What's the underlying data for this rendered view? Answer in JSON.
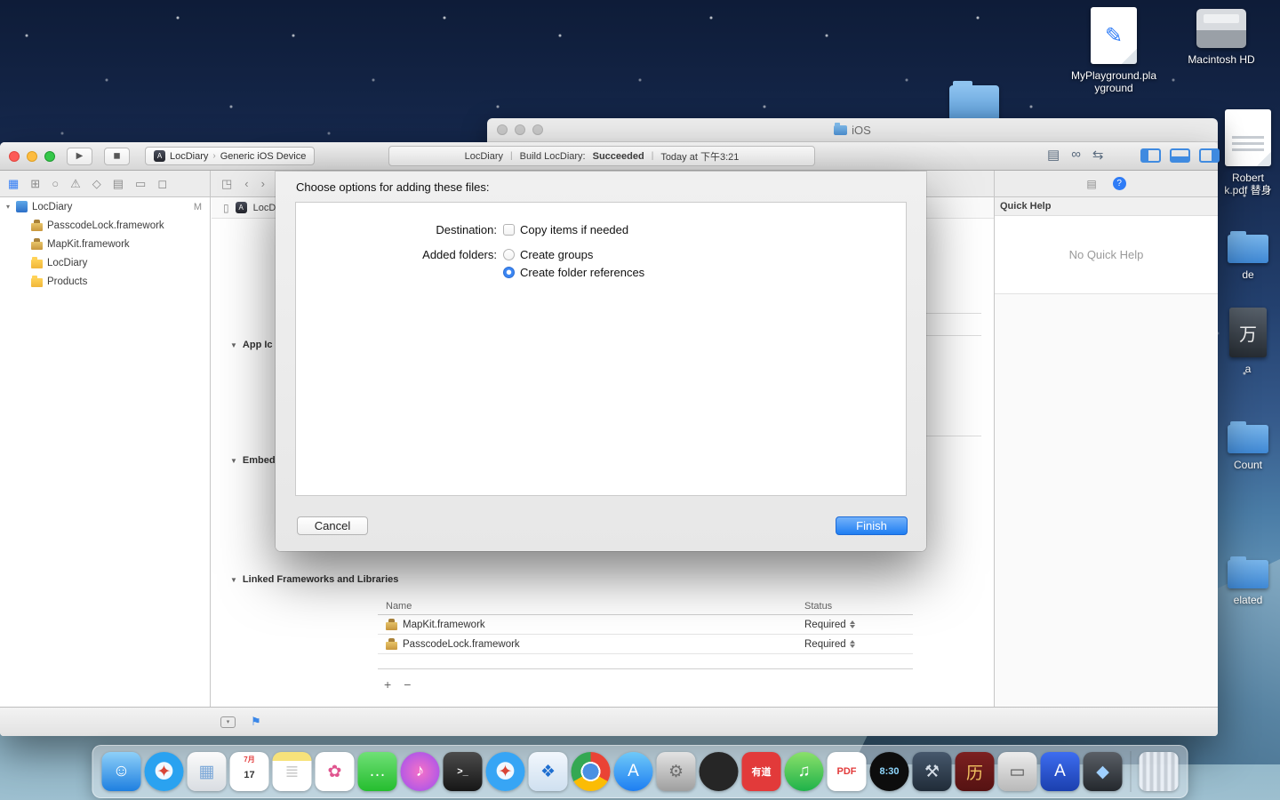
{
  "desktop": {
    "top_icons": [
      {
        "name": "myplayground-icon",
        "type": "playground",
        "glyph": "✎",
        "line1": "MyPlayground.pla",
        "line2": "yground"
      },
      {
        "name": "macintosh-hd-icon",
        "type": "harddrive",
        "glyph": "",
        "line1": "Macintosh HD",
        "line2": ""
      }
    ],
    "right_items": [
      {
        "name": "pdf-alias",
        "type": "pdf",
        "glyph": "",
        "line1": "Robert",
        "line2": "k.pdf 替身"
      },
      {
        "name": "folder-de",
        "type": "folder",
        "glyph": "",
        "line1": "de",
        "line2": ""
      },
      {
        "name": "artwork-a",
        "type": "artwork",
        "glyph": "万",
        "line1": "a",
        "line2": ""
      },
      {
        "name": "folder-count",
        "type": "folder",
        "glyph": "",
        "line1": "Count",
        "line2": ""
      },
      {
        "name": "folder-related",
        "type": "folder",
        "glyph": "",
        "line1": "elated",
        "line2": ""
      }
    ]
  },
  "finder": {
    "title": "iOS"
  },
  "xcode": {
    "toolbar": {
      "play": "▶",
      "stop": "◼",
      "scheme_icon": "A",
      "scheme_name": "LocDiary",
      "scheme_chevron": "›",
      "device": "Generic iOS Device",
      "status_project": "LocDiary",
      "status_sep": "|",
      "status_build": "Build LocDiary:",
      "status_state": "Succeeded",
      "status_time": "Today at 下午3:21"
    },
    "editor_mode_icons": [
      {
        "name": "standard-editor-button",
        "glyph": "▤"
      },
      {
        "name": "assistant-editor-button",
        "glyph": "∞"
      },
      {
        "name": "version-editor-button",
        "glyph": "⇆"
      }
    ],
    "navigator_tabs": [
      {
        "name": "project-navigator-icon",
        "glyph": "▦",
        "cls": "active"
      },
      {
        "name": "symbol-navigator-icon",
        "glyph": "⊞",
        "cls": ""
      },
      {
        "name": "find-navigator-icon",
        "glyph": "○",
        "cls": ""
      },
      {
        "name": "issue-navigator-icon",
        "glyph": "⚠",
        "cls": ""
      },
      {
        "name": "test-navigator-icon",
        "glyph": "◇",
        "cls": ""
      },
      {
        "name": "debug-navigator-icon",
        "glyph": "▤",
        "cls": ""
      },
      {
        "name": "breakpoint-navigator-icon",
        "glyph": "▭",
        "cls": ""
      },
      {
        "name": "report-navigator-icon",
        "glyph": "◻",
        "cls": ""
      }
    ],
    "navigator_items": [
      {
        "name": "nav-item-locdiary-project",
        "label": "LocDiary",
        "badge": "M",
        "arrow": "▾",
        "icon": "icon-project",
        "level": "lvl0"
      },
      {
        "name": "nav-item-passcodelock-framework",
        "label": "PasscodeLock.framework",
        "badge": "",
        "arrow": "",
        "icon": "icon-framework",
        "level": "lvl1"
      },
      {
        "name": "nav-item-mapkit-framework",
        "label": "MapKit.framework",
        "badge": "",
        "arrow": "",
        "icon": "icon-framework",
        "level": "lvl1"
      },
      {
        "name": "nav-item-locdiary-group",
        "label": "LocDiary",
        "badge": "",
        "arrow": "",
        "icon": "icon-folder",
        "level": "lvl1"
      },
      {
        "name": "nav-item-products-group",
        "label": "Products",
        "badge": "",
        "arrow": "",
        "icon": "icon-folder",
        "level": "lvl1"
      }
    ],
    "editor": {
      "related_icon": "◳",
      "back": "‹",
      "forward": "›",
      "jump_doc_icon": "▯",
      "jump_app_icon": "A",
      "jump_tab": "LocD",
      "sections": [
        {
          "name": "section-app-icons",
          "label": "App Ic",
          "cls": "sec-0",
          "tri": "▼"
        },
        {
          "name": "section-embedded",
          "label": "Embed",
          "cls": "sec-1",
          "tri": "▼"
        },
        {
          "name": "section-linked-frameworks",
          "label": "Linked Frameworks and Libraries",
          "cls": "sec-2",
          "tri": "▼"
        }
      ],
      "table": {
        "col_name": "Name",
        "col_status": "Status",
        "rows": [
          {
            "name_text": "MapKit.framework",
            "status": "Required"
          },
          {
            "name_text": "PasscodeLock.framework",
            "status": "Required"
          }
        ],
        "add": "+",
        "remove": "−"
      }
    },
    "inspector": {
      "file_icon": "▤",
      "help_icon": "?",
      "header": "Quick Help",
      "empty": "No Quick Help"
    },
    "bottombar": {
      "filter_glyph": "▾",
      "flag": "⚑"
    }
  },
  "dialog": {
    "title": "Choose options for adding these files:",
    "destination_label": "Destination:",
    "copy_label": "Copy items if needed",
    "added_folders_label": "Added folders:",
    "create_groups_label": "Create groups",
    "create_refs_label": "Create folder references",
    "cancel_label": "Cancel",
    "finish_label": "Finish"
  },
  "dock": {
    "items": [
      {
        "name": "finder-dock-icon",
        "glyph": "☺",
        "fg": "#ffffff",
        "bg": "linear-gradient(180deg,#8ed0f8,#1e7fe0)",
        "cls": ""
      },
      {
        "name": "safari-dock-icon",
        "glyph": "✦",
        "fg": "#d94436",
        "bg": "radial-gradient(circle at 50% 48%,#f2f8ff 0 30%,#2aa2f0 32% 100%)",
        "cls": "round"
      },
      {
        "name": "preview-dock-icon",
        "glyph": "▦",
        "fg": "#7aa7d8",
        "bg": "linear-gradient(180deg,#fbfbfb,#d9dde2)",
        "cls": ""
      },
      {
        "name": "calendar-dock-icon",
        "glyph": "17",
        "fg": "#333333",
        "bg": "#ffffff",
        "cls": "calendar small-text",
        "top_text": "7月"
      },
      {
        "name": "notes-dock-icon",
        "glyph": "≣",
        "fg": "#c9c9c9",
        "bg": "linear-gradient(180deg,#f7e27a 0 10px,#ffffff 10px)",
        "cls": ""
      },
      {
        "name": "photos-dock-icon",
        "glyph": "✿",
        "fg": "#e0558f",
        "bg": "#ffffff",
        "cls": ""
      },
      {
        "name": "messages-dock-icon",
        "glyph": "…",
        "fg": "#ffffff",
        "bg": "linear-gradient(180deg,#6fe076,#25bd2f)",
        "cls": ""
      },
      {
        "name": "itunes-dock-icon",
        "glyph": "♪",
        "fg": "#ffffff",
        "bg": "radial-gradient(circle,#f571c8,#9b4ff0)",
        "cls": "round"
      },
      {
        "name": "terminal-dock-icon",
        "glyph": ">_",
        "fg": "#ffffff",
        "bg": "linear-gradient(180deg,#4c4c4c,#161616)",
        "cls": "small-text"
      },
      {
        "name": "compass-dock-icon",
        "glyph": "✦",
        "fg": "#d94436",
        "bg": "radial-gradient(circle at 50% 48%,#f2f8ff 0 30%,#37a5f5 32% 100%)",
        "cls": "round"
      },
      {
        "name": "dropbox-dock-icon",
        "glyph": "❖",
        "fg": "#1f6fd0",
        "bg": "linear-gradient(180deg,#f2f7fd,#cfe0f0)",
        "cls": ""
      },
      {
        "name": "chrome-dock-icon",
        "glyph": "",
        "fg": "#ffffff",
        "bg": "radial-gradient(circle,#4a90e2 0 9px,#ffffff 9px 11px,transparent 11px),conic-gradient(#ea4335 0 120deg,#fbbc05 120deg 240deg,#34a853 240deg 360deg)",
        "cls": "round"
      },
      {
        "name": "appstore-dock-icon",
        "glyph": "A",
        "fg": "#ffffff",
        "bg": "linear-gradient(180deg,#6fc9f8,#1d7ef2)",
        "cls": "round"
      },
      {
        "name": "sysprefs-dock-icon",
        "glyph": "⚙",
        "fg": "#6e6e6e",
        "bg": "linear-gradient(180deg,#e3e3e3,#9f9f9f)",
        "cls": ""
      },
      {
        "name": "github-dock-icon",
        "glyph": "",
        "fg": "#ffffff",
        "bg": "radial-gradient(circle,#262626 0 75%,#404040)",
        "cls": "round"
      },
      {
        "name": "youdao-dict-dock-icon",
        "glyph": "有道",
        "fg": "#ffffff",
        "bg": "#e23a3a",
        "cls": "small-text"
      },
      {
        "name": "qqmusic-dock-icon",
        "glyph": "♫",
        "fg": "#ffffff",
        "bg": "linear-gradient(180deg,#8ae06a,#1fb24a)",
        "cls": "round"
      },
      {
        "name": "pdf-expert-dock-icon",
        "glyph": "PDF",
        "fg": "#e23a3a",
        "bg": "#ffffff",
        "cls": "small-text"
      },
      {
        "name": "clock-dock-icon",
        "glyph": "8:30",
        "fg": "#8fd8ff",
        "bg": "radial-gradient(circle,#0d0d0d 0 75%,#2e2e2e)",
        "cls": "small-text round"
      },
      {
        "name": "xcode-dock-icon",
        "glyph": "⚒",
        "fg": "#d7dfe8",
        "bg": "linear-gradient(180deg,#46586c,#202c38)",
        "cls": ""
      },
      {
        "name": "wannianli-dock-icon",
        "glyph": "历",
        "fg": "#f0c060",
        "bg": "linear-gradient(180deg,#7c2020,#551212)",
        "cls": ""
      },
      {
        "name": "display-dock-icon",
        "glyph": "▭",
        "fg": "#5a5a5a",
        "bg": "linear-gradient(180deg,#ececec,#b9b9b9)",
        "cls": ""
      },
      {
        "name": "a-app-dock-icon",
        "glyph": "A",
        "fg": "#ffffff",
        "bg": "linear-gradient(180deg,#3d6df0,#1b3fae)",
        "cls": ""
      },
      {
        "name": "dark-app-dock-icon",
        "glyph": "◆",
        "fg": "#9fd0ff",
        "bg": "linear-gradient(180deg,#5a5f66,#24282d)",
        "cls": ""
      }
    ]
  }
}
